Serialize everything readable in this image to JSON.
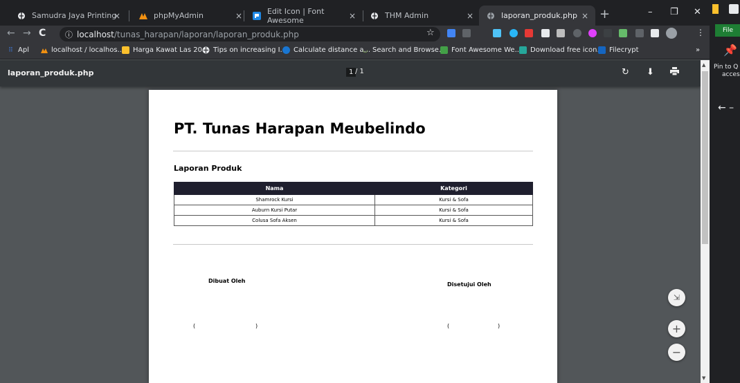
{
  "tabs": [
    {
      "title": "Samudra Jaya Printing",
      "icon": "globe-icon"
    },
    {
      "title": "phpMyAdmin",
      "icon": "phpmyadmin-icon"
    },
    {
      "title": "Edit Icon | Font Awesome",
      "icon": "fontawesome-icon"
    },
    {
      "title": "THM Admin",
      "icon": "globe-icon"
    },
    {
      "title": "laporan_produk.php",
      "icon": "globe-icon"
    }
  ],
  "tab_close": "×",
  "new_tab": "+",
  "window": {
    "minimize": "–",
    "restore": "❐",
    "close": "✕"
  },
  "address": {
    "info": "ⓘ",
    "host": "localhost",
    "path": "/tunas_harapan/laporan/laporan_produk.php",
    "star": "☆"
  },
  "nav": {
    "back": "←",
    "forward": "→",
    "reload": "C"
  },
  "bookmarks": [
    {
      "label": "Apl"
    },
    {
      "label": "localhost / localhos..."
    },
    {
      "label": "Harga Kawat Las 20..."
    },
    {
      "label": "Tips on increasing I..."
    },
    {
      "label": "Calculate distance a..."
    },
    {
      "label": "Search and Browse..."
    },
    {
      "label": "Font Awesome We..."
    },
    {
      "label": "Download free icon..."
    },
    {
      "label": "Filecrypt"
    }
  ],
  "bookmarks_more": "»",
  "pdf": {
    "title": "laporan_produk.php",
    "page_current": "1",
    "page_total": "/ 1",
    "rotate_icon": "↻",
    "download_icon": "⬇",
    "print_icon": "🖶"
  },
  "side_panel": {
    "file": "File",
    "pin_text_1": "Pin to Q",
    "pin_text_2": "acces",
    "back": "←  –"
  },
  "document": {
    "company": "PT. Tunas Harapan Meubelindo",
    "report_title": "Laporan Produk",
    "columns": [
      "Nama",
      "Kategori"
    ],
    "rows": [
      [
        "Shamrock Kursi",
        "Kursi & Sofa"
      ],
      [
        "Auburn Kursi Putar",
        "Kursi & Sofa"
      ],
      [
        "Colusa Sofa Aksen",
        "Kursi & Sofa"
      ]
    ],
    "made_by": "Dibuat Oleh",
    "approved_by": "Disetujui Oleh",
    "paren_open": "(",
    "paren_close": ")"
  },
  "zoom": {
    "fit": "⇲",
    "plus": "+",
    "minus": "−"
  },
  "colors": {
    "active_tab": "#35363a",
    "tab_bg": "#202124",
    "pdf_bar": "#323639",
    "viewer_bg": "#525659",
    "table_header": "#1f1f2e"
  }
}
